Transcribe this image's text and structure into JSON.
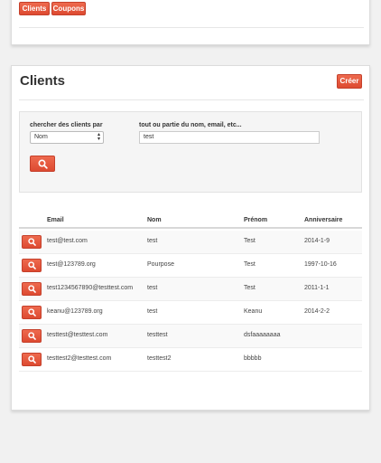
{
  "top_nav": {
    "clients_label": "Clients",
    "coupons_label": "Coupons"
  },
  "clients": {
    "title": "Clients",
    "create_label": "Créer",
    "search": {
      "by_label": "chercher des clients par",
      "by_value": "Nom",
      "query_label": "tout ou partie du nom, email, etc...",
      "query_value": "test"
    },
    "table": {
      "headers": [
        "Email",
        "Nom",
        "Prénom",
        "Anniversaire"
      ],
      "rows": [
        [
          "test@test.com",
          "test",
          "Test",
          "2014-1-9"
        ],
        [
          "test@123789.org",
          "Pourpose",
          "Test",
          "1997-10-16"
        ],
        [
          "test1234567890@testtest.com",
          "test",
          "Test",
          "2011-1-1"
        ],
        [
          "keanu@123789.org",
          "test",
          "Keanu",
          "2014-2-2"
        ],
        [
          "testtest@testtest.com",
          "testtest",
          "dsfaaaaaaaa",
          ""
        ],
        [
          "testtest2@testtest.com",
          "testtest2",
          "bbbbb",
          ""
        ]
      ]
    }
  },
  "colors": {
    "accent": "#e05438",
    "accent_border": "#c5402b",
    "panel_bg": "#f5f5f5"
  },
  "icons": {
    "row_action": "search-icon",
    "search_submit": "search-icon"
  }
}
